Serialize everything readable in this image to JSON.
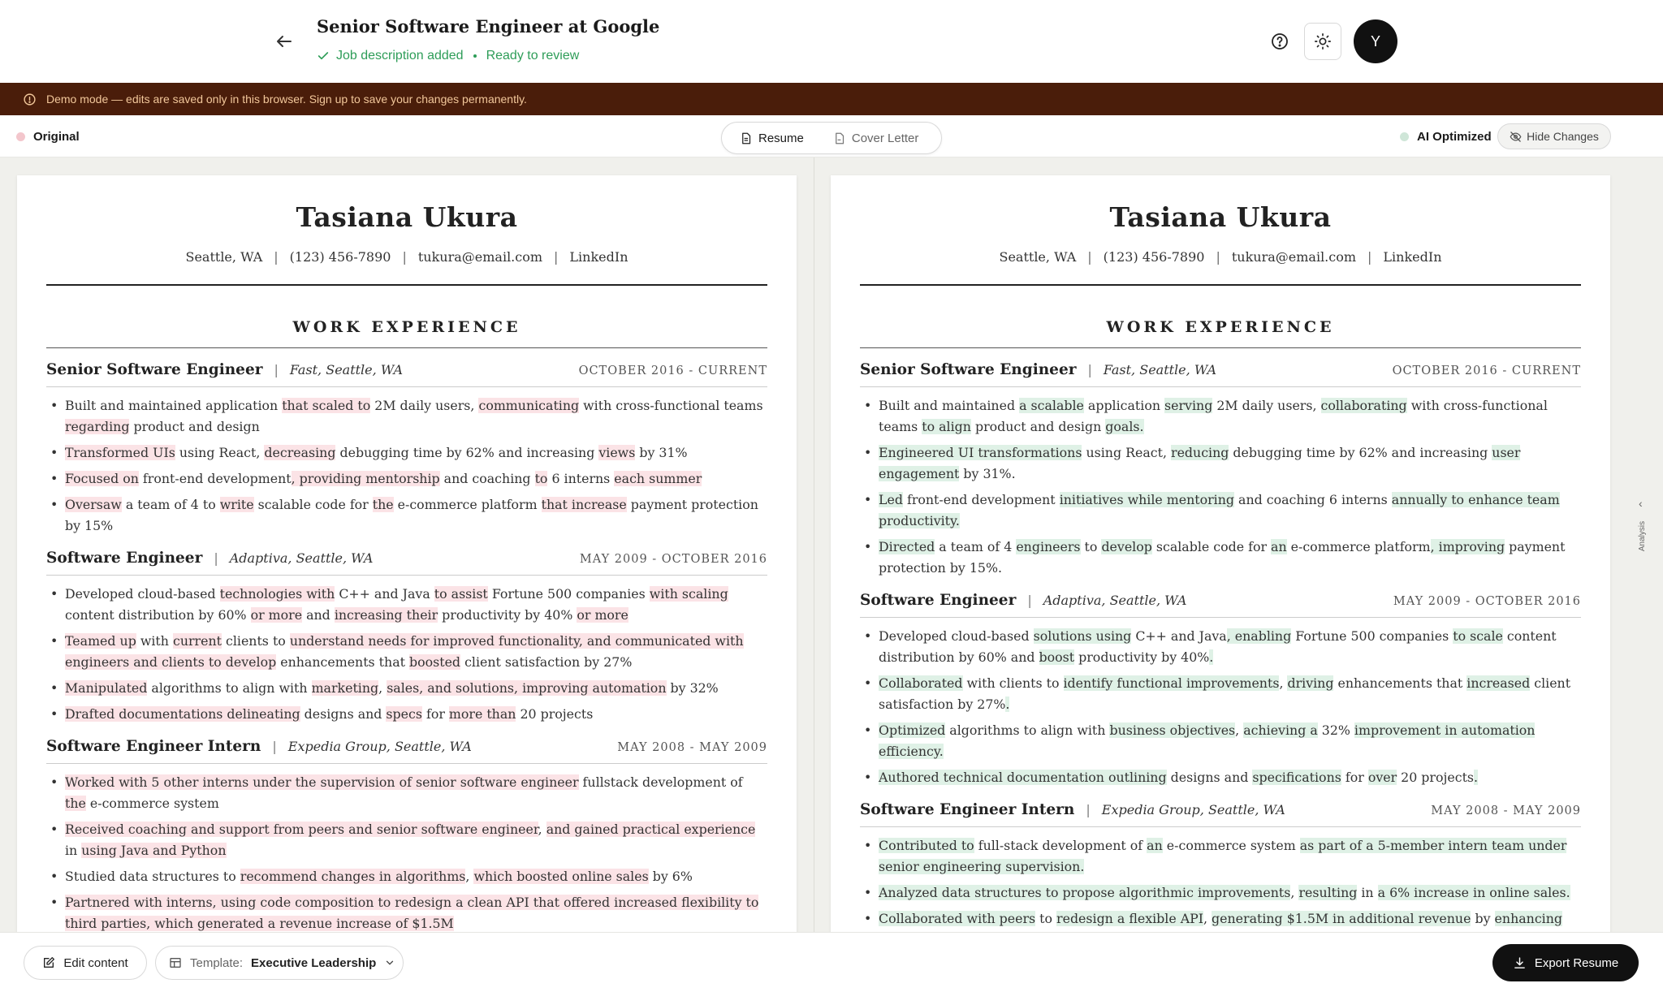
{
  "header": {
    "title": "Senior Software Engineer at Google",
    "status_primary": "Job description added",
    "status_secondary": "Ready to review",
    "avatar_initial": "Y"
  },
  "banner": {
    "text": "Demo mode — edits are saved only in this browser. Sign up to save your changes permanently."
  },
  "compare": {
    "original_label": "Original",
    "optimized_label": "AI Optimized",
    "hide_changes_label": "Hide Changes",
    "tabs": [
      {
        "label": "Resume",
        "active": true
      },
      {
        "label": "Cover Letter",
        "active": false
      }
    ]
  },
  "colors": {
    "removed_highlight": "#fbe3e6",
    "added_highlight": "#dff1e6",
    "banner_bg": "#4a1d0a",
    "status_green": "#2e9d58"
  },
  "resume": {
    "name": "Tasiana Ukura",
    "contact": [
      "Seattle, WA",
      "(123) 456-7890",
      "tukura@email.com",
      "LinkedIn"
    ],
    "section_title": "WORK EXPERIENCE"
  },
  "original": {
    "jobs": [
      {
        "role": "Senior Software Engineer",
        "company": "Fast, Seattle, WA",
        "dates": "OCTOBER 2016 - CURRENT",
        "bullets": [
          [
            [
              "Built and maintained application ",
              0
            ],
            [
              "that scaled to",
              1
            ],
            [
              " 2M daily users, ",
              0
            ],
            [
              "communicating",
              1
            ],
            [
              " with cross-functional teams ",
              0
            ],
            [
              "regarding",
              1
            ],
            [
              " product and design",
              0
            ]
          ],
          [
            [
              "Transformed UIs",
              1
            ],
            [
              " using React, ",
              0
            ],
            [
              "decreasing",
              1
            ],
            [
              " debugging time by 62% and increasing ",
              0
            ],
            [
              "views",
              1
            ],
            [
              " by 31%",
              0
            ]
          ],
          [
            [
              "Focused on",
              1
            ],
            [
              " front-end development",
              0
            ],
            [
              ", providing mentorship",
              1
            ],
            [
              " and coaching ",
              0
            ],
            [
              "to",
              1
            ],
            [
              " 6 interns ",
              0
            ],
            [
              "each summer",
              1
            ]
          ],
          [
            [
              "Oversaw",
              1
            ],
            [
              " a team of 4 to ",
              0
            ],
            [
              "write",
              1
            ],
            [
              " scalable code for ",
              0
            ],
            [
              "the",
              1
            ],
            [
              " e-commerce platform ",
              0
            ],
            [
              "that increase",
              1
            ],
            [
              " payment protection by 15%",
              0
            ]
          ]
        ]
      },
      {
        "role": "Software Engineer",
        "company": "Adaptiva, Seattle, WA",
        "dates": "MAY 2009 - OCTOBER 2016",
        "bullets": [
          [
            [
              "Developed cloud-based ",
              0
            ],
            [
              "technologies with",
              1
            ],
            [
              " C++ and Java ",
              0
            ],
            [
              "to assist",
              1
            ],
            [
              " Fortune 500 companies ",
              0
            ],
            [
              "with scaling",
              1
            ],
            [
              " content distribution by 60% ",
              0
            ],
            [
              "or more",
              1
            ],
            [
              " and ",
              0
            ],
            [
              "increasing their",
              1
            ],
            [
              " productivity by 40% ",
              0
            ],
            [
              "or more",
              1
            ]
          ],
          [
            [
              "Teamed up",
              1
            ],
            [
              " with ",
              0
            ],
            [
              "current",
              1
            ],
            [
              " clients to ",
              0
            ],
            [
              "understand needs for improved functionality, and communicated with engineers and clients to develop",
              1
            ],
            [
              " enhancements that ",
              0
            ],
            [
              "boosted",
              1
            ],
            [
              " client satisfaction by 27%",
              0
            ]
          ],
          [
            [
              "Manipulated",
              1
            ],
            [
              " algorithms to align with ",
              0
            ],
            [
              "marketing",
              1
            ],
            [
              ", ",
              0
            ],
            [
              "sales, and solutions, improving automation",
              1
            ],
            [
              " by 32%",
              0
            ]
          ],
          [
            [
              "Drafted documentations delineating",
              1
            ],
            [
              " designs and ",
              0
            ],
            [
              "specs",
              1
            ],
            [
              " for ",
              0
            ],
            [
              "more than",
              1
            ],
            [
              " 20 projects",
              0
            ]
          ]
        ]
      },
      {
        "role": "Software Engineer Intern",
        "company": "Expedia Group, Seattle, WA",
        "dates": "MAY 2008 - MAY 2009",
        "bullets": [
          [
            [
              "Worked with 5 other interns under the supervision of senior software engineer",
              1
            ],
            [
              " fullstack development of ",
              0
            ],
            [
              "the",
              1
            ],
            [
              " e-commerce system",
              0
            ]
          ],
          [
            [
              "Received coaching and support from peers and senior software engineer",
              1
            ],
            [
              ", ",
              0
            ],
            [
              "and gained practical experience",
              1
            ],
            [
              " in ",
              0
            ],
            [
              "using Java and Python",
              1
            ]
          ],
          [
            [
              "Studied data structures",
              0
            ],
            [
              " to ",
              0
            ],
            [
              "recommend changes in algorithms",
              1
            ],
            [
              ", ",
              0
            ],
            [
              "which boosted online sales",
              1
            ],
            [
              " by 6%",
              0
            ]
          ],
          [
            [
              "Partnered with interns, using code composition to redesign a clean API that offered increased flexibility to third parties, which generated a revenue increase of $1.5M",
              1
            ]
          ]
        ]
      }
    ]
  },
  "optimized": {
    "jobs": [
      {
        "role": "Senior Software Engineer",
        "company": "Fast, Seattle, WA",
        "dates": "OCTOBER 2016 - CURRENT",
        "bullets": [
          [
            [
              "Built and maintained ",
              0
            ],
            [
              "a scalable",
              1
            ],
            [
              " application ",
              0
            ],
            [
              "serving",
              1
            ],
            [
              " 2M daily users, ",
              0
            ],
            [
              "collaborating",
              1
            ],
            [
              " with cross-functional teams ",
              0
            ],
            [
              "to align",
              1
            ],
            [
              " product and design ",
              0
            ],
            [
              "goals.",
              1
            ]
          ],
          [
            [
              "Engineered UI transformations",
              1
            ],
            [
              " using React, ",
              0
            ],
            [
              "reducing",
              1
            ],
            [
              " debugging time by 62% and increasing ",
              0
            ],
            [
              "user engagement",
              1
            ],
            [
              " by 31%.",
              0
            ]
          ],
          [
            [
              "Led",
              1
            ],
            [
              " front-end development ",
              0
            ],
            [
              "initiatives while mentoring",
              1
            ],
            [
              " and coaching 6 interns ",
              0
            ],
            [
              "annually to enhance team productivity.",
              1
            ]
          ],
          [
            [
              "Directed",
              1
            ],
            [
              " a team of 4 ",
              0
            ],
            [
              "engineers",
              1
            ],
            [
              " to ",
              0
            ],
            [
              "develop",
              1
            ],
            [
              " scalable code for ",
              0
            ],
            [
              "an",
              1
            ],
            [
              " e-commerce platform",
              0
            ],
            [
              ", improving",
              1
            ],
            [
              " payment protection by 15%.",
              0
            ]
          ]
        ]
      },
      {
        "role": "Software Engineer",
        "company": "Adaptiva, Seattle, WA",
        "dates": "MAY 2009 - OCTOBER 2016",
        "bullets": [
          [
            [
              "Developed cloud-based ",
              0
            ],
            [
              "solutions using",
              1
            ],
            [
              " C++ and Java",
              0
            ],
            [
              ", enabling",
              1
            ],
            [
              " Fortune 500 companies ",
              0
            ],
            [
              "to scale",
              1
            ],
            [
              " content distribution by 60% and ",
              0
            ],
            [
              "boost",
              1
            ],
            [
              " productivity by 40%",
              0
            ],
            [
              ".",
              1
            ]
          ],
          [
            [
              "Collaborated",
              1
            ],
            [
              " with clients to ",
              0
            ],
            [
              "identify functional improvements",
              1
            ],
            [
              ", ",
              0
            ],
            [
              "driving",
              1
            ],
            [
              " enhancements that ",
              0
            ],
            [
              "increased",
              1
            ],
            [
              " client satisfaction by 27%",
              0
            ],
            [
              ".",
              1
            ]
          ],
          [
            [
              "Optimized",
              1
            ],
            [
              " algorithms to align with ",
              0
            ],
            [
              "business objectives",
              1
            ],
            [
              ", ",
              0
            ],
            [
              "achieving a",
              1
            ],
            [
              " 32% ",
              0
            ],
            [
              "improvement in automation efficiency.",
              1
            ]
          ],
          [
            [
              "Authored technical documentation outlining",
              1
            ],
            [
              " designs and ",
              0
            ],
            [
              "specifications",
              1
            ],
            [
              " for ",
              0
            ],
            [
              "over",
              1
            ],
            [
              " 20 projects",
              0
            ],
            [
              ".",
              1
            ]
          ]
        ]
      },
      {
        "role": "Software Engineer Intern",
        "company": "Expedia Group, Seattle, WA",
        "dates": "MAY 2008 - MAY 2009",
        "bullets": [
          [
            [
              "Contributed to",
              1
            ],
            [
              " full-stack development of ",
              0
            ],
            [
              "an",
              1
            ],
            [
              " e-commerce system ",
              0
            ],
            [
              "as part of a 5-member intern team under senior engineering supervision.",
              1
            ]
          ],
          [
            [
              "Analyzed data structures to propose algorithmic improvements",
              1
            ],
            [
              ", ",
              0
            ],
            [
              "resulting",
              1
            ],
            [
              " in ",
              0
            ],
            [
              "a 6% increase in online sales.",
              1
            ]
          ],
          [
            [
              "Collaborated with peers",
              1
            ],
            [
              " to ",
              0
            ],
            [
              "redesign a flexible API",
              1
            ],
            [
              ", ",
              0
            ],
            [
              "generating $1.5M in additional revenue",
              1
            ],
            [
              " by ",
              0
            ],
            [
              "enhancing third-party integration capabilities.",
              1
            ]
          ]
        ]
      }
    ]
  },
  "side_panel": {
    "label": "Analysis"
  },
  "footer": {
    "edit_label": "Edit content",
    "template_prefix": "Template:",
    "template_value": "Executive Leadership",
    "export_label": "Export Resume"
  }
}
